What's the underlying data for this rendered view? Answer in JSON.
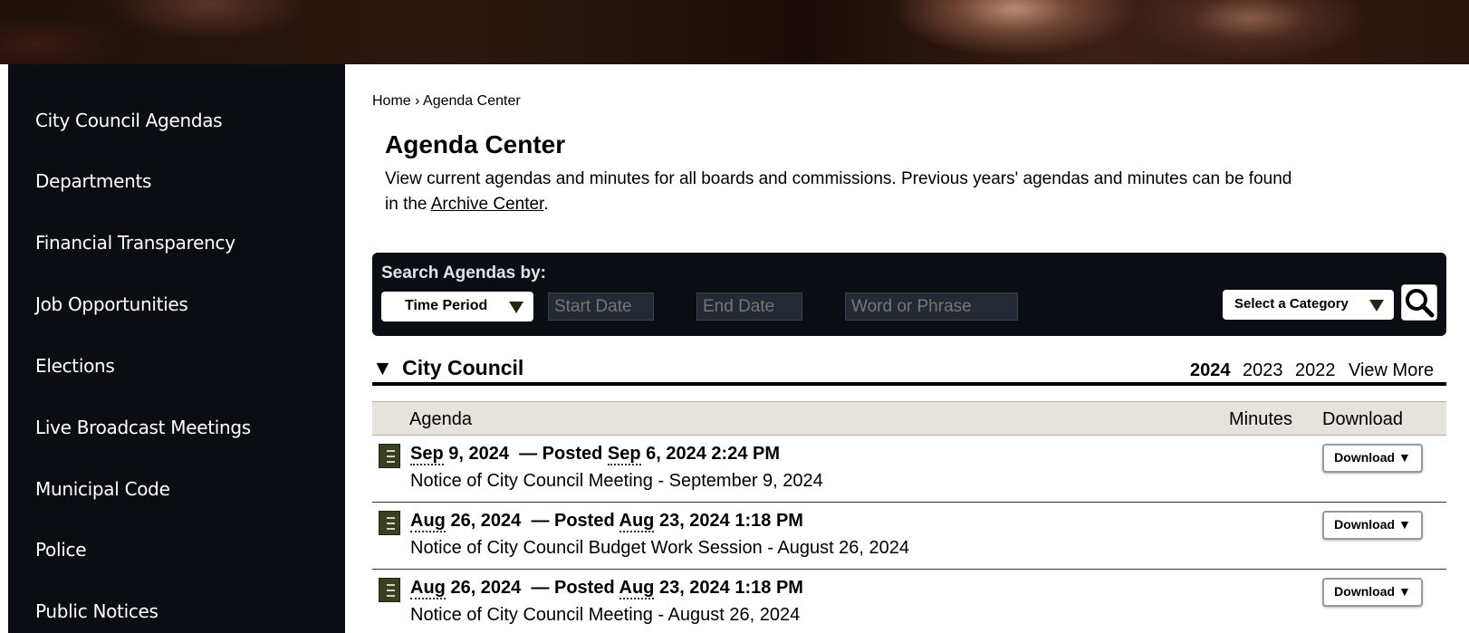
{
  "sidebar": {
    "items": [
      {
        "label": "City Council Agendas"
      },
      {
        "label": "Departments"
      },
      {
        "label": "Financial Transparency"
      },
      {
        "label": "Job Opportunities"
      },
      {
        "label": "Elections"
      },
      {
        "label": "Live Broadcast Meetings"
      },
      {
        "label": "Municipal Code"
      },
      {
        "label": "Police"
      },
      {
        "label": "Public Notices"
      }
    ]
  },
  "breadcrumb": {
    "home": "Home",
    "separator": "›",
    "current": "Agenda Center"
  },
  "page": {
    "title": "Agenda Center",
    "intro_text": "View current agendas and minutes for all boards and commissions. Previous years' agendas and minutes can be found in the ",
    "archive_link": "Archive Center",
    "intro_end": "."
  },
  "search": {
    "label": "Search Agendas by:",
    "time_period": "Time Period",
    "start_placeholder": "Start Date",
    "end_placeholder": "End Date",
    "phrase_placeholder": "Word or Phrase",
    "category": "Select a Category"
  },
  "category": {
    "arrow": "▼",
    "title": "City Council",
    "years": [
      "2024",
      "2023",
      "2022"
    ],
    "view_more": "View More"
  },
  "table": {
    "headers": {
      "agenda": "Agenda",
      "minutes": "Minutes",
      "download": "Download"
    },
    "rows": [
      {
        "month": "Sep",
        "date_rest": " 9, 2024",
        "posted_label": "— Posted ",
        "posted_month": "Sep",
        "posted_rest": " 6, 2024 2:24 PM",
        "description": "Notice of City Council Meeting - September 9, 2024",
        "download": "Download ▼"
      },
      {
        "month": "Aug",
        "date_rest": " 26, 2024",
        "posted_label": "— Posted ",
        "posted_month": "Aug",
        "posted_rest": " 23, 2024 1:18 PM",
        "description": "Notice of City Council Budget Work Session - August 26, 2024",
        "download": "Download ▼"
      },
      {
        "month": "Aug",
        "date_rest": " 26, 2024",
        "posted_label": "— Posted ",
        "posted_month": "Aug",
        "posted_rest": " 23, 2024 1:18 PM",
        "description": "Notice of City Council Meeting - August 26, 2024",
        "download": "Download ▼"
      }
    ]
  },
  "colors": {
    "sidebar_bg": "#0a0d11",
    "header_row_bg": "#e6e3dd",
    "icon_green": "#3a3f22"
  }
}
